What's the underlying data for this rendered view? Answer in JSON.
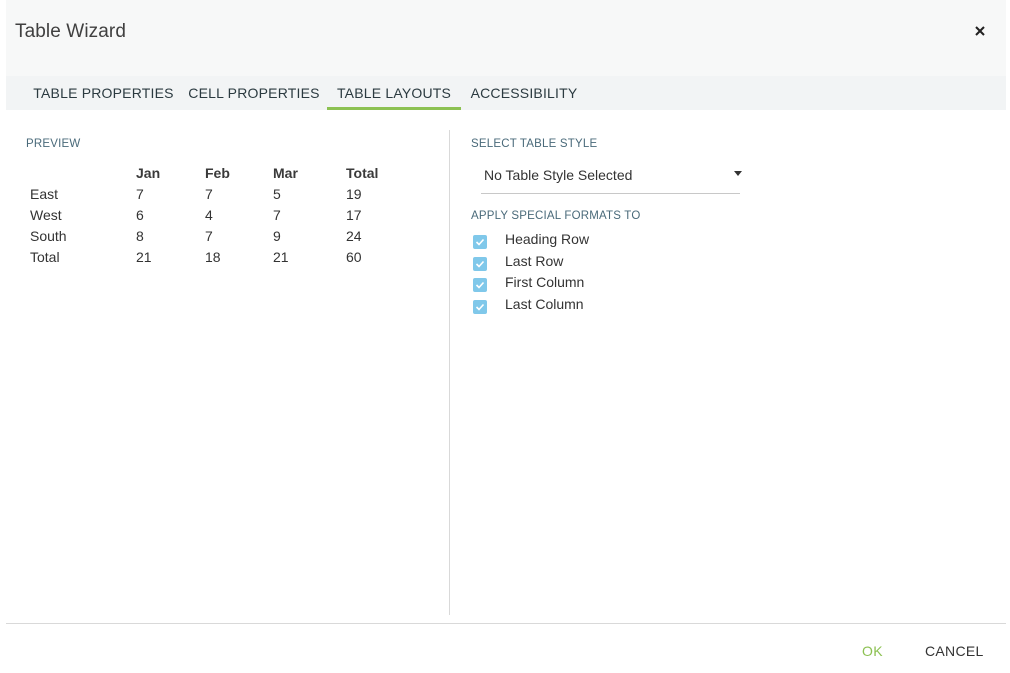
{
  "dialog": {
    "title": "Table Wizard",
    "close_icon": "close-icon"
  },
  "tabs": [
    {
      "label": "TABLE PROPERTIES",
      "active": false
    },
    {
      "label": "CELL PROPERTIES",
      "active": false
    },
    {
      "label": "TABLE LAYOUTS",
      "active": true
    },
    {
      "label": "ACCESSIBILITY",
      "active": false
    }
  ],
  "colors": {
    "accent_green": "#8cc152",
    "checkbox_blue": "#80c8ea",
    "section_label": "#4a6a7a"
  },
  "preview": {
    "label": "PREVIEW",
    "headers": [
      "",
      "Jan",
      "Feb",
      "Mar",
      "Total"
    ],
    "rows": [
      [
        "East",
        "7",
        "7",
        "5",
        "19"
      ],
      [
        "West",
        "6",
        "4",
        "7",
        "17"
      ],
      [
        "South",
        "8",
        "7",
        "9",
        "24"
      ],
      [
        "Total",
        "21",
        "18",
        "21",
        "60"
      ]
    ]
  },
  "style": {
    "label": "SELECT TABLE STYLE",
    "selected": "No Table Style Selected",
    "dropdown_icon": "caret-down-icon"
  },
  "special_formats": {
    "label": "APPLY SPECIAL FORMATS TO",
    "options": [
      {
        "label": "Heading Row",
        "checked": true
      },
      {
        "label": "Last Row",
        "checked": true
      },
      {
        "label": "First Column",
        "checked": true
      },
      {
        "label": "Last Column",
        "checked": true
      }
    ]
  },
  "footer": {
    "ok_label": "OK",
    "cancel_label": "CANCEL"
  }
}
